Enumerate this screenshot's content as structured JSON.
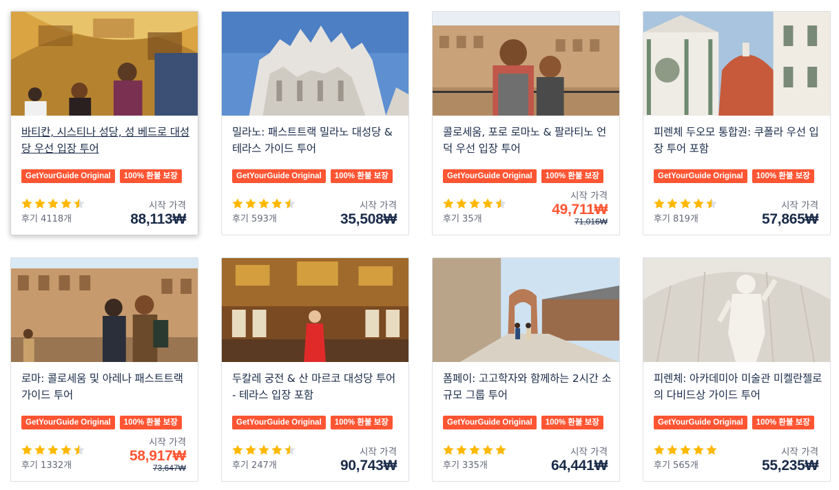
{
  "colors": {
    "accent": "#ff5533",
    "text": "#1a2b49",
    "muted": "#63687a",
    "star": "#ffb800"
  },
  "cards": [
    {
      "title": "바티칸, 시스티나 성당, 성 베드로 대성당 우선 입장 투어",
      "badge_original": "GetYourGuide Original",
      "badge_refund": "100% 환불 보장",
      "rating": 4.5,
      "reviews": "후기 4118개",
      "from_label": "시작 가격",
      "price": "88,113₩",
      "old_price": "",
      "thumb": "vatican-gallery"
    },
    {
      "title": "밀라노: 패스트트랙 밀라노 대성당 & 테라스 가이드 투어",
      "badge_original": "GetYourGuide Original",
      "badge_refund": "100% 환불 보장",
      "rating": 4.5,
      "reviews": "후기 593개",
      "from_label": "시작 가격",
      "price": "35,508₩",
      "old_price": "",
      "thumb": "milan-cathedral"
    },
    {
      "title": "콜로세움, 포로 로마노 & 팔라티노 언덕 우선 입장 투어",
      "badge_original": "GetYourGuide Original",
      "badge_refund": "100% 환불 보장",
      "rating": 4.5,
      "reviews": "후기 35개",
      "from_label": "시작 가격",
      "price": "49,711₩",
      "old_price": "71,016₩",
      "thumb": "colosseum-visitors"
    },
    {
      "title": "피렌체 두오모 통합권: 쿠폴라 우선 입장 투어 포함",
      "badge_original": "GetYourGuide Original",
      "badge_refund": "100% 환불 보장",
      "rating": 4.5,
      "reviews": "후기 819개",
      "from_label": "시작 가격",
      "price": "57,865₩",
      "old_price": "",
      "thumb": "florence-duomo"
    },
    {
      "title": "로마: 콜로세움 및 아레나 패스트트랙 가이드 투어",
      "badge_original": "GetYourGuide Original",
      "badge_refund": "100% 환불 보장",
      "rating": 4.5,
      "reviews": "후기 1332개",
      "from_label": "시작 가격",
      "price": "58,917₩",
      "old_price": "73,647₩",
      "thumb": "colosseum-arena"
    },
    {
      "title": "두칼레 궁전 & 산 마르코 대성당 투어 - 테라스 입장 포함",
      "badge_original": "GetYourGuide Original",
      "badge_refund": "100% 환불 보장",
      "rating": 4.5,
      "reviews": "후기 247개",
      "from_label": "시작 가격",
      "price": "90,743₩",
      "old_price": "",
      "thumb": "doge-palace"
    },
    {
      "title": "폼페이: 고고학자와 함께하는 2시간 소규모 그룹 투어",
      "badge_original": "GetYourGuide Original",
      "badge_refund": "100% 환불 보장",
      "rating": 5,
      "reviews": "후기 335개",
      "from_label": "시작 가격",
      "price": "64,441₩",
      "old_price": "",
      "thumb": "pompeii-street"
    },
    {
      "title": "피렌체: 아카데미아 미술관 미켈란젤로의 다비드상 가이드 투어",
      "badge_original": "GetYourGuide Original",
      "badge_refund": "100% 환불 보장",
      "rating": 5,
      "reviews": "후기 565개",
      "from_label": "시작 가격",
      "price": "55,235₩",
      "old_price": "",
      "thumb": "david-statue"
    }
  ]
}
